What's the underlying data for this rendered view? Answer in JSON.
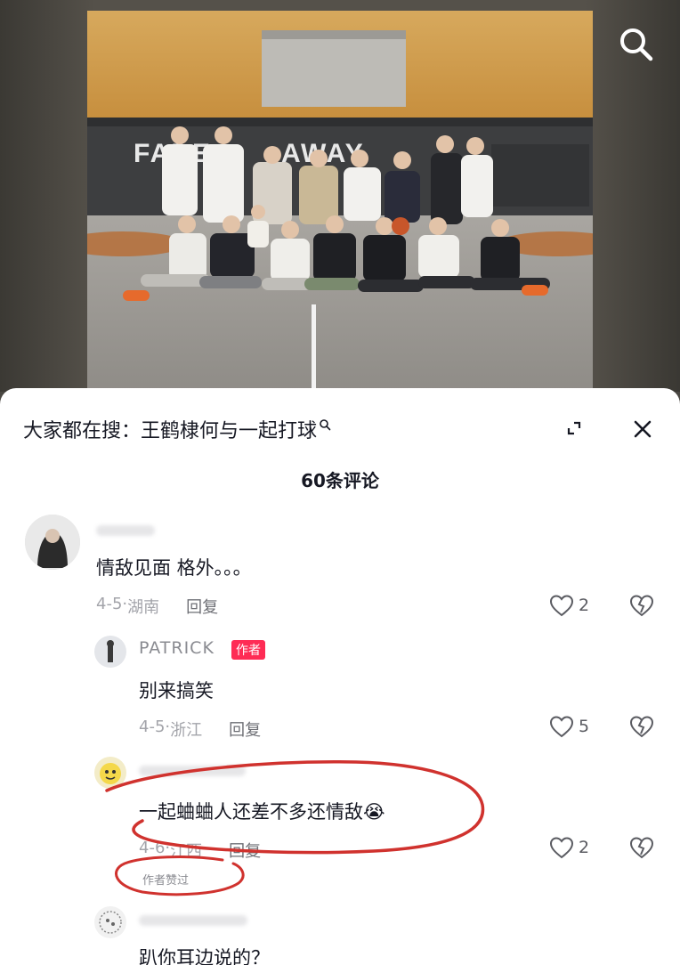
{
  "video": {
    "wall_text_left": "FADE",
    "wall_text_right": "AWAY",
    "search_icon": "search-icon"
  },
  "sheet": {
    "trending_prefix": "大家都在搜：",
    "trending_query": "王鹤棣何与一起打球",
    "expand_icon": "expand-icon",
    "close_icon": "close-icon",
    "comment_count": "60条评论"
  },
  "comments": [
    {
      "text": "情敌见面 格外。。。",
      "date": "4-5",
      "location": "湖南",
      "reply_label": "回复",
      "likes": "2"
    },
    {
      "username": "PATRICK",
      "badge": "作者",
      "text": "别来搞笑",
      "date": "4-5",
      "location": "浙江",
      "reply_label": "回复",
      "likes": "5"
    },
    {
      "text": "一起蛐蛐人还差不多还情敌",
      "emoji": "😭",
      "date": "4-6",
      "location": "江西",
      "reply_label": "回复",
      "likes": "2",
      "liked_tag": "作者赞过"
    },
    {
      "text": "趴你耳边说的？"
    }
  ],
  "colors": {
    "accent": "#fe2c55",
    "annotation": "#d0322e",
    "text_primary": "#161823",
    "text_secondary": "#a3a4aa"
  }
}
